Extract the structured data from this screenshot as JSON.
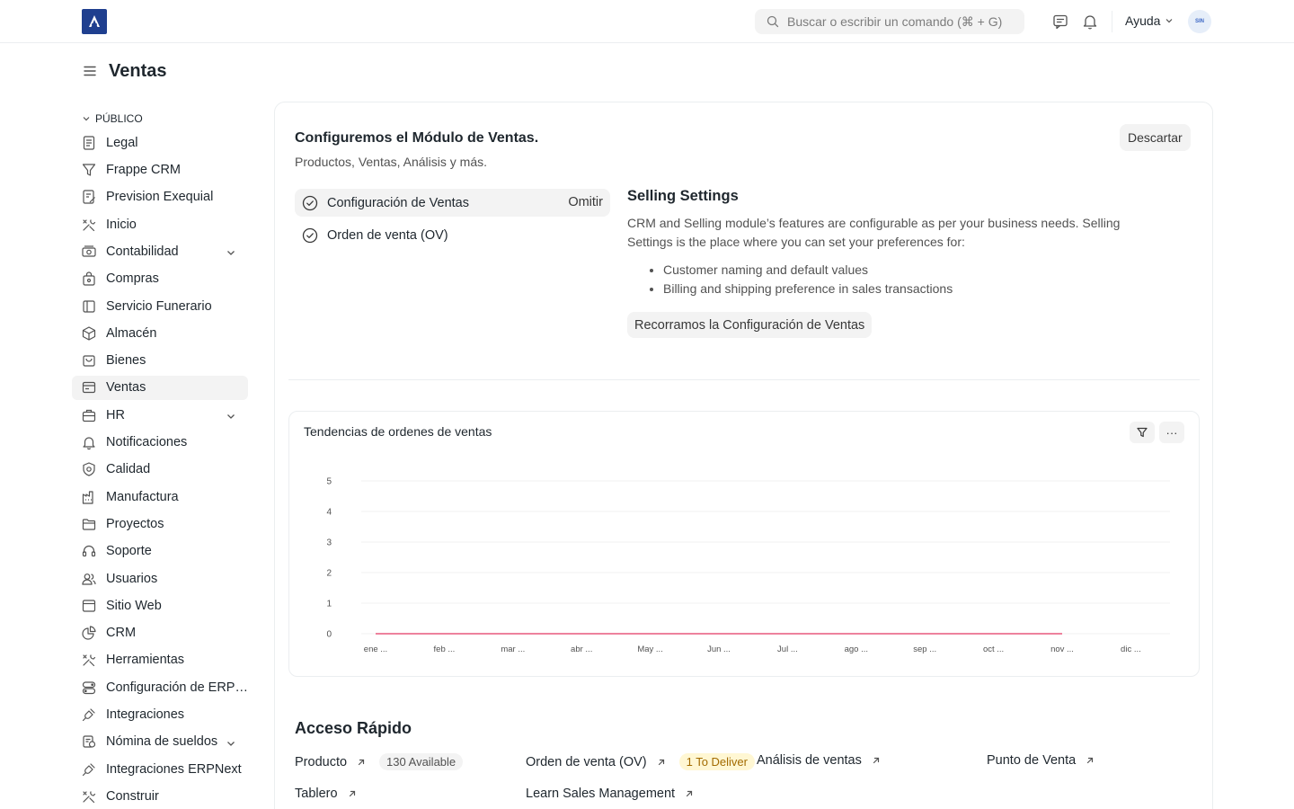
{
  "navbar": {
    "logo_icon": "erpnext-logo",
    "search_placeholder": "Buscar o escribir un comando (⌘ + G)",
    "help_label": "Ayuda",
    "avatar_initials": "SIN"
  },
  "page": {
    "title": "Ventas"
  },
  "sidebar": {
    "section_label": "PÚBLICO",
    "items": [
      {
        "label": "Legal",
        "icon": "file-text-icon"
      },
      {
        "label": "Frappe CRM",
        "icon": "filter-icon"
      },
      {
        "label": "Prevision Exequial",
        "icon": "file-edit-icon"
      },
      {
        "label": "Inicio",
        "icon": "tools-icon"
      },
      {
        "label": "Contabilidad",
        "icon": "money-icon",
        "expandable": true
      },
      {
        "label": "Compras",
        "icon": "shopping-bag-icon"
      },
      {
        "label": "Servicio Funerario",
        "icon": "book-icon"
      },
      {
        "label": "Almacén",
        "icon": "box-icon"
      },
      {
        "label": "Bienes",
        "icon": "archive-icon"
      },
      {
        "label": "Ventas",
        "icon": "receipt-icon",
        "active": true
      },
      {
        "label": "HR",
        "icon": "briefcase-icon",
        "expandable": true
      },
      {
        "label": "Notificaciones",
        "icon": "bell-icon"
      },
      {
        "label": "Calidad",
        "icon": "shield-icon"
      },
      {
        "label": "Manufactura",
        "icon": "factory-icon"
      },
      {
        "label": "Proyectos",
        "icon": "folder-icon"
      },
      {
        "label": "Soporte",
        "icon": "headset-icon"
      },
      {
        "label": "Usuarios",
        "icon": "users-icon"
      },
      {
        "label": "Sitio Web",
        "icon": "browser-icon"
      },
      {
        "label": "CRM",
        "icon": "pie-chart-icon"
      },
      {
        "label": "Herramientas",
        "icon": "tools-icon"
      },
      {
        "label": "Configuración de ERPNext",
        "icon": "settings-toggle-icon"
      },
      {
        "label": "Integraciones",
        "icon": "plug-icon"
      },
      {
        "label": "Nómina de sueldos",
        "icon": "payroll-icon",
        "expandable": true
      },
      {
        "label": "Integraciones ERPNext",
        "icon": "plug-icon"
      },
      {
        "label": "Construir",
        "icon": "tools-icon"
      }
    ]
  },
  "onboarding": {
    "title": "Configuremos el Módulo de Ventas.",
    "subtitle": "Productos, Ventas, Análisis y más.",
    "dismiss_label": "Descartar",
    "steps": [
      {
        "label": "Configuración de Ventas",
        "action": "Omitir",
        "active": true
      },
      {
        "label": "Orden de venta (OV)",
        "action": "",
        "active": false
      }
    ],
    "detail": {
      "title": "Selling Settings",
      "description": "CRM and Selling module’s features are configurable as per your business needs. Selling Settings is the place where you can set your preferences for:",
      "bullets": [
        "Customer naming and default values",
        "Billing and shipping preference in sales transactions"
      ],
      "button_label": "Recorramos la Configuración de Ventas"
    }
  },
  "chart": {
    "title": "Tendencias de ordenes de ventas",
    "filter_icon": "filter-icon",
    "menu_label": "···"
  },
  "chart_data": {
    "type": "line",
    "title": "Tendencias de ordenes de ventas",
    "xlabel": "",
    "ylabel": "",
    "categories": [
      "ene ...",
      "feb ...",
      "mar ...",
      "abr ...",
      "May ...",
      "Jun ...",
      "Jul ...",
      "ago ...",
      "sep ...",
      "oct ...",
      "nov ...",
      "dic ..."
    ],
    "ylim": [
      0,
      5
    ],
    "yticks": [
      0,
      1,
      2,
      3,
      4,
      5
    ],
    "series": [
      {
        "values": [
          0,
          0,
          0,
          0,
          0,
          0,
          0,
          0,
          0,
          0,
          0,
          null
        ],
        "color": "#e8587d"
      }
    ],
    "grid": true
  },
  "quick_access": {
    "title": "Acceso Rápido",
    "items": [
      {
        "label": "Producto",
        "badge": "130 Available",
        "badge_color": "gray"
      },
      {
        "label": "Orden de venta (OV)",
        "badge": "1 To Deliver",
        "badge_color": "yellow"
      },
      {
        "label": "Análisis de ventas",
        "badge": ""
      },
      {
        "label": "Punto de Venta",
        "badge": ""
      },
      {
        "label": "Tablero",
        "badge": ""
      },
      {
        "label": "Learn Sales Management",
        "badge": ""
      }
    ]
  }
}
